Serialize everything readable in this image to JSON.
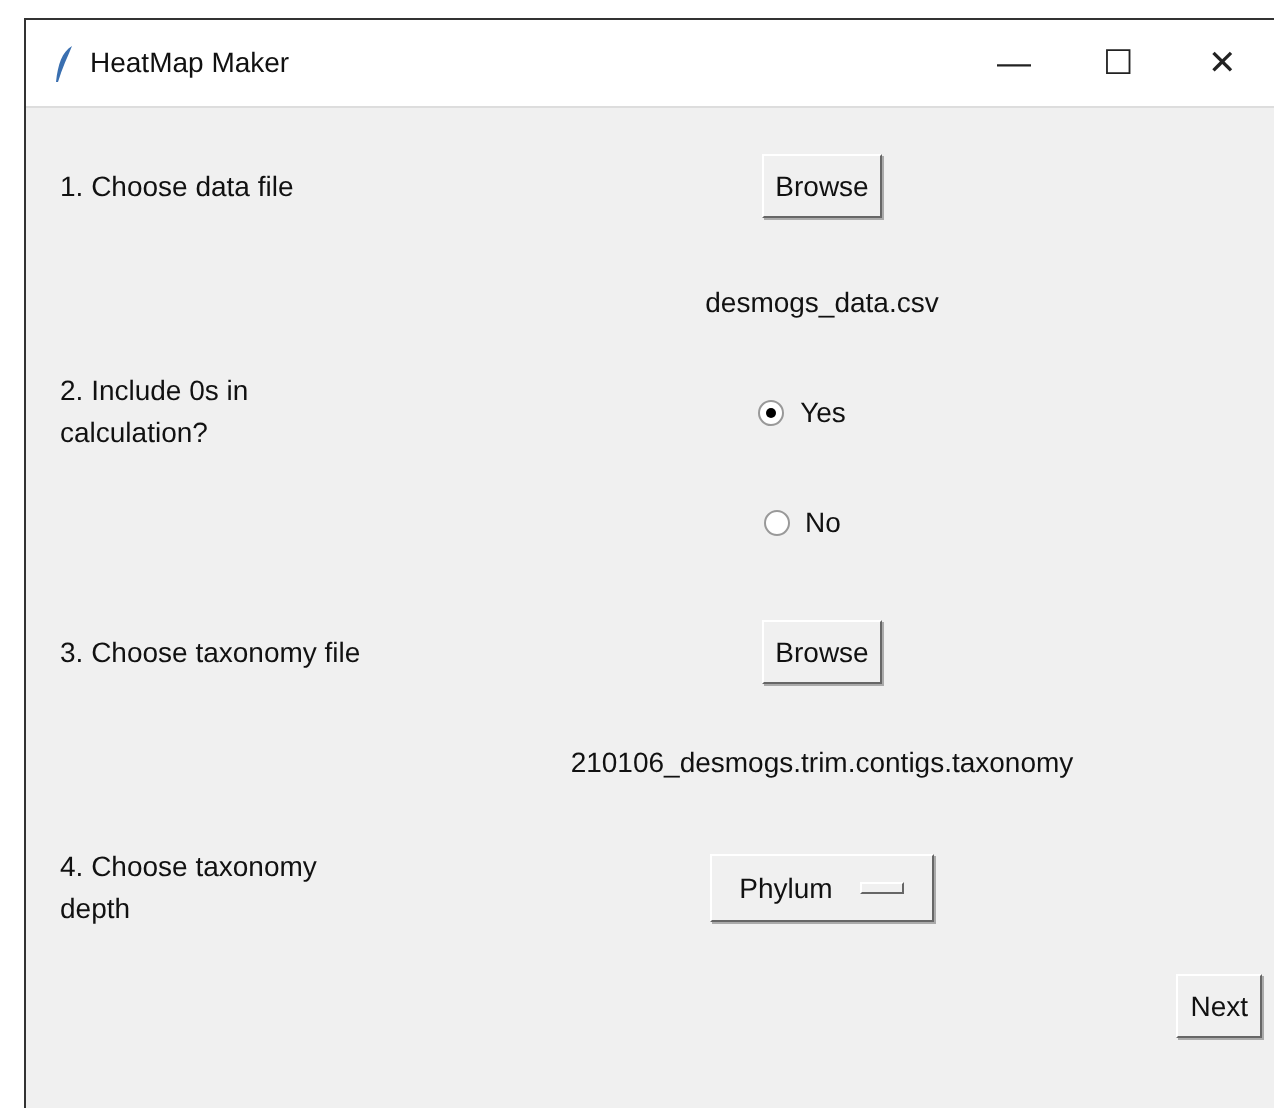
{
  "window": {
    "title": "HeatMap Maker",
    "controls": [
      "—",
      "☐",
      "✕"
    ]
  },
  "rows": [
    {
      "kind": "button",
      "label": "1. Choose data file",
      "button": "Browse"
    },
    {
      "kind": "text",
      "text": "desmogs_data.csv"
    },
    {
      "kind": "radio",
      "label": "2. Include 0s in calculation?",
      "option": "Yes",
      "selected": true
    },
    {
      "kind": "radio",
      "option": "No",
      "selected": false
    },
    {
      "kind": "button",
      "label": "3. Choose taxonomy file",
      "button": "Browse"
    },
    {
      "kind": "text",
      "text": "210106_desmogs.trim.contigs.taxonomy"
    },
    {
      "kind": "menu",
      "label": "4. Choose taxonomy depth",
      "value": "Phylum"
    }
  ],
  "next_button": "Next"
}
